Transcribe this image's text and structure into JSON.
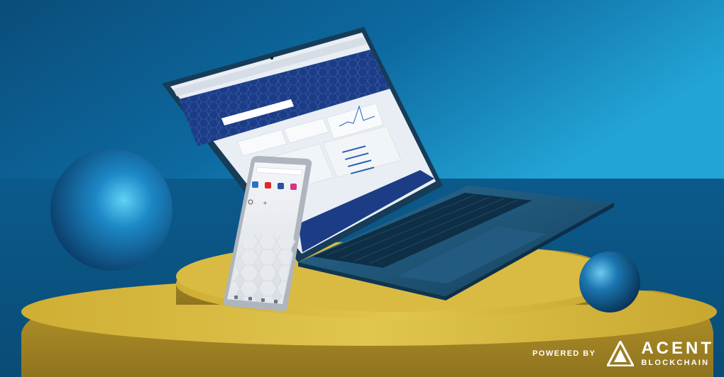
{
  "brand": {
    "powered_by": "POWERED BY",
    "name": "ACENT",
    "tagline": "BLOCKCHAIN"
  },
  "colors": {
    "background_top": "#0d5f92",
    "background_highlight": "#2aa7d8",
    "podium": "#d6b53a",
    "sphere": "#1f7fc0",
    "laptop_body": "#1e4f6f",
    "screen_header": "#1c3d86"
  },
  "icons": [
    "acent-logo-icon",
    "search-icon",
    "mail-icon",
    "youtube-icon",
    "facebook-icon",
    "instagram-icon"
  ]
}
